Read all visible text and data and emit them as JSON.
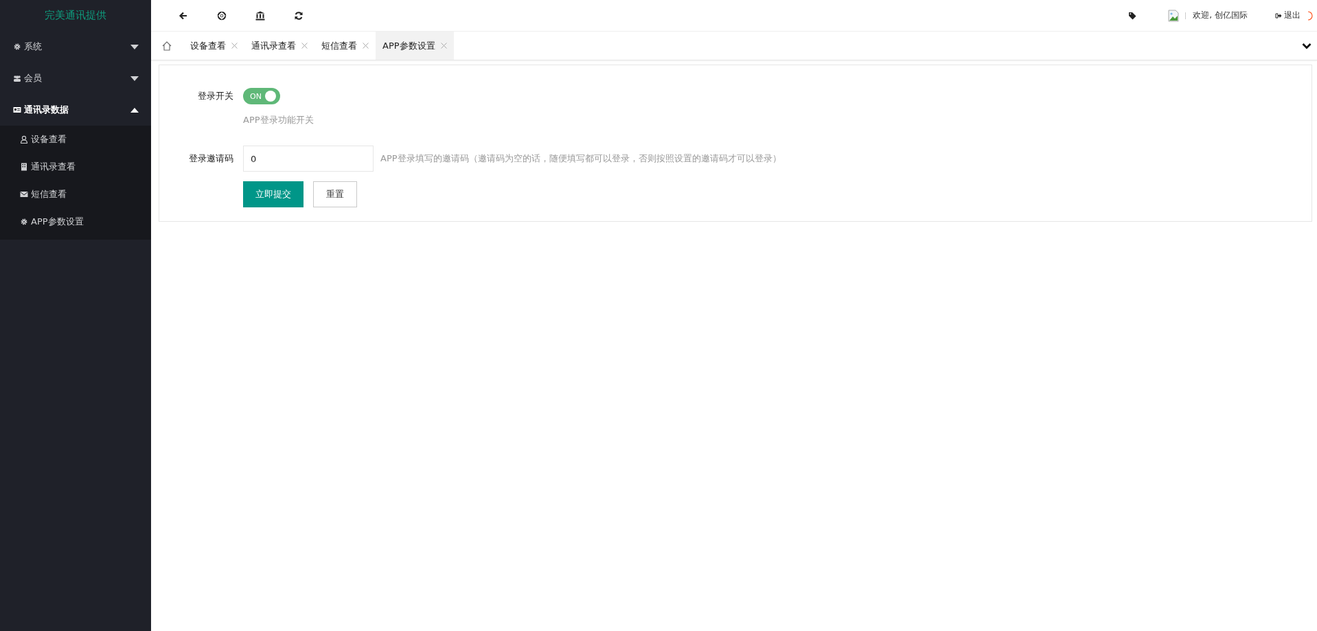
{
  "brand": "完美通讯提供",
  "sidebar": {
    "items": [
      {
        "label": "系统",
        "expanded": false
      },
      {
        "label": "会员",
        "expanded": false
      },
      {
        "label": "通讯录数据",
        "expanded": true,
        "children": [
          {
            "label": "设备查看"
          },
          {
            "label": "通讯录查看"
          },
          {
            "label": "短信查看"
          },
          {
            "label": "APP参数设置"
          }
        ]
      }
    ]
  },
  "header": {
    "welcome": "欢迎, 创亿国际",
    "logout": "退出"
  },
  "tabs": [
    {
      "label": "设备查看",
      "selected": false
    },
    {
      "label": "通讯录查看",
      "selected": false
    },
    {
      "label": "短信查看",
      "selected": false
    },
    {
      "label": "APP参数设置",
      "selected": true
    }
  ],
  "form": {
    "toggle": {
      "label": "登录开关",
      "on": true,
      "text": "ON",
      "hint": "APP登录功能开关"
    },
    "invite": {
      "label": "登录邀请码",
      "value": "0",
      "hint": "APP登录填写的邀请码（邀请码为空的话，随便填写都可以登录，否则按照设置的邀请码才可以登录）"
    },
    "buttons": [
      {
        "label": "立即提交",
        "kind": "primary"
      },
      {
        "label": "重置",
        "kind": "plain"
      }
    ]
  }
}
